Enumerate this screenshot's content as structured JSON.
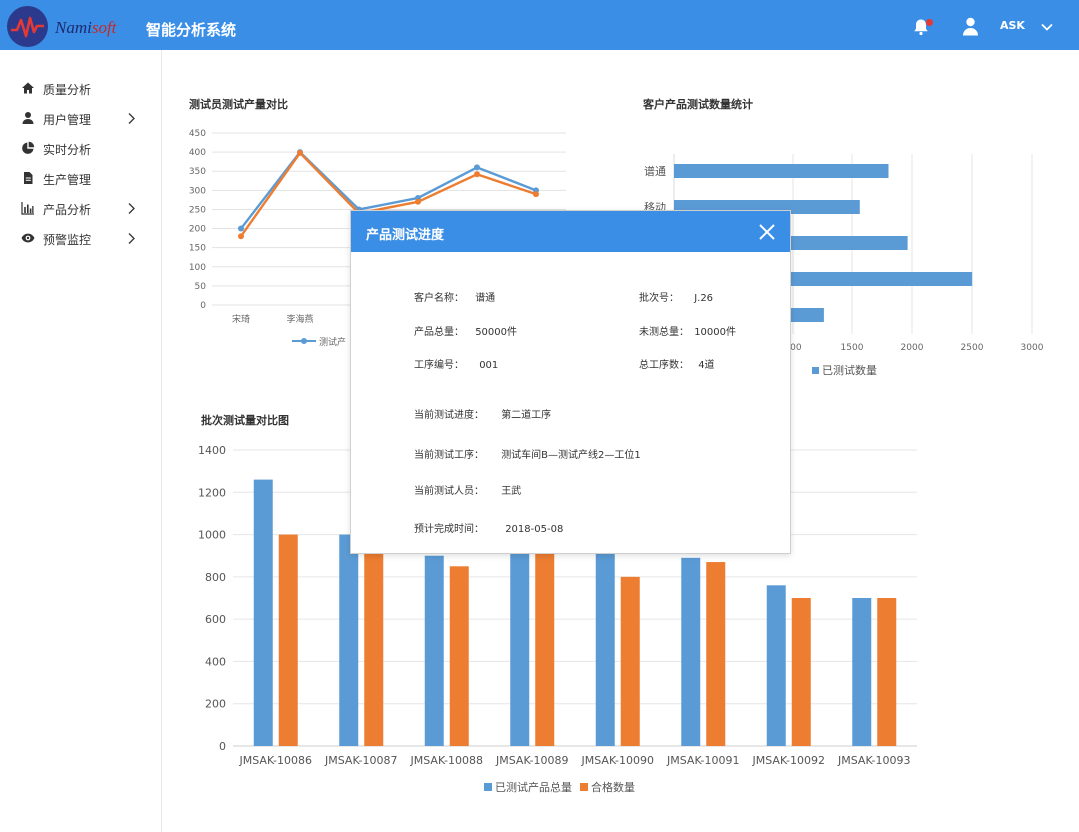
{
  "header": {
    "brand_main": "Nami",
    "brand_accent": "soft",
    "app_title": "智能分析系统",
    "user_name": "ASK"
  },
  "sidebar": {
    "items": [
      {
        "label": "质量分析",
        "icon": "home-icon",
        "has_children": false
      },
      {
        "label": "用户管理",
        "icon": "user-icon",
        "has_children": true
      },
      {
        "label": "实时分析",
        "icon": "pie-chart-icon",
        "has_children": false
      },
      {
        "label": "生产管理",
        "icon": "document-icon",
        "has_children": false
      },
      {
        "label": "产品分析",
        "icon": "bar-chart-icon",
        "has_children": true
      },
      {
        "label": "预警监控",
        "icon": "eye-icon",
        "has_children": true
      }
    ]
  },
  "charts": {
    "tester_output": {
      "title": "测试员测试产量对比",
      "legend": [
        "测试产"
      ]
    },
    "customer_test": {
      "title": "客户产品测试数量统计",
      "legend": [
        "已测试数量"
      ]
    },
    "batch_compare": {
      "title": "批次测试量对比图",
      "legend": [
        "已测试产品总量",
        "合格数量"
      ]
    }
  },
  "chart_data": [
    {
      "type": "line",
      "title": "测试员测试产量对比",
      "categories": [
        "宋琦",
        "李海燕",
        "",
        "",
        "",
        ""
      ],
      "series": [
        {
          "name": "测试产",
          "values": [
            200,
            400,
            250,
            280,
            360,
            300
          ],
          "color": "#5b9bd5"
        },
        {
          "values": [
            180,
            398,
            240,
            270,
            342,
            290
          ],
          "color": "#ed7d31"
        }
      ],
      "ylim": [
        0,
        450
      ],
      "yticks": [
        0,
        50,
        100,
        150,
        200,
        250,
        300,
        350,
        400,
        450
      ],
      "grid": true,
      "legend_position": "bottom"
    },
    {
      "type": "bar",
      "orientation": "horizontal",
      "title": "客户产品测试数量统计",
      "categories": [
        "谱通",
        "移动",
        "",
        "",
        ""
      ],
      "series": [
        {
          "name": "已测试数量",
          "values": [
            1800,
            1560,
            1960,
            2500,
            1260
          ],
          "color": "#5b9bd5"
        }
      ],
      "xlim": [
        1000,
        3000
      ],
      "xticks": [
        "000",
        "1500",
        "2000",
        "2500",
        "3000"
      ],
      "grid": true,
      "legend_position": "bottom"
    },
    {
      "type": "bar",
      "title": "批次测试量对比图",
      "categories": [
        "JMSAK-10086",
        "JMSAK-10087",
        "JMSAK-10088",
        "JMSAK-10089",
        "JMSAK-10090",
        "JMSAK-10091",
        "JMSAK-10092",
        "JMSAK-10093"
      ],
      "series": [
        {
          "name": "已测试产品总量",
          "values": [
            1260,
            1000,
            900,
            1000,
            960,
            890,
            760,
            700
          ],
          "color": "#5b9bd5"
        },
        {
          "name": "合格数量",
          "values": [
            1000,
            920,
            850,
            980,
            800,
            870,
            700,
            700
          ],
          "color": "#ed7d31"
        }
      ],
      "ylim": [
        0,
        1400
      ],
      "yticks": [
        0,
        200,
        400,
        600,
        800,
        1000,
        1200,
        1400
      ],
      "grid": true,
      "legend_position": "bottom"
    }
  ],
  "modal": {
    "title": "产品测试进度",
    "fields": {
      "customer_label": "客户名称：",
      "customer_value": "谱通",
      "batch_label": "批次号：",
      "batch_value": "J.26",
      "total_label": "产品总量：",
      "total_value": "50000件",
      "untested_label": "未测总量：",
      "untested_value": "10000件",
      "process_no_label": "工序编号：",
      "process_no_value": "001",
      "process_count_label": "总工序数：",
      "process_count_value": "4道",
      "progress_label": "当前测试进度：",
      "progress_value": "第二道工序",
      "station_label": "当前测试工序：",
      "station_value": "测试车间B—测试产线2—工位1",
      "tester_label": "当前测试人员：",
      "tester_value": "王武",
      "eta_label": "预计完成时间：",
      "eta_value": "2018-05-08"
    }
  },
  "colors": {
    "header": "#3a8ee6",
    "series_blue": "#5b9bd5",
    "series_orange": "#ed7d31",
    "notification_dot": "#e53935"
  }
}
